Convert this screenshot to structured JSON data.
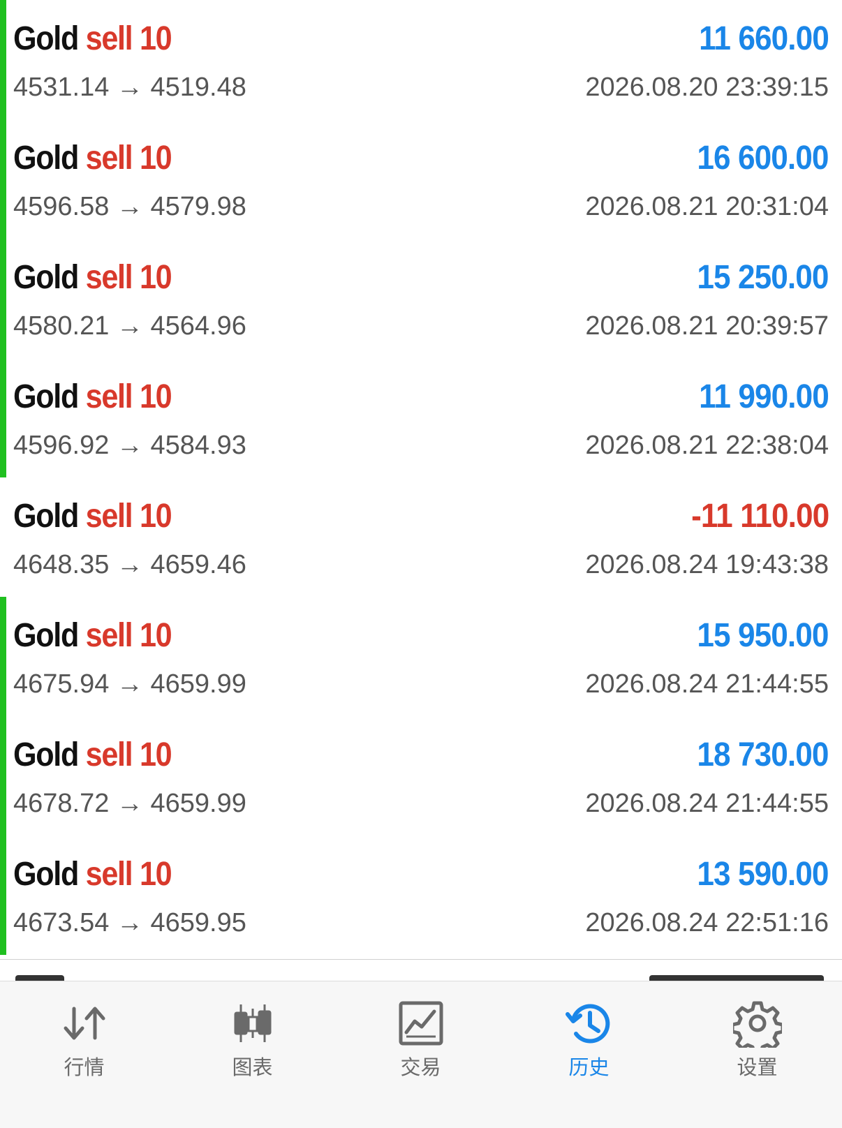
{
  "trades": [
    {
      "symbol": "Gold",
      "side": "sell",
      "volume": "10",
      "prices": "4531.14 → 4519.48",
      "profit": "11 660.00",
      "time": "2026.08.20 23:39:15",
      "is_loss": false
    },
    {
      "symbol": "Gold",
      "side": "sell",
      "volume": "10",
      "prices": "4596.58 → 4579.98",
      "profit": "16 600.00",
      "time": "2026.08.21 20:31:04",
      "is_loss": false
    },
    {
      "symbol": "Gold",
      "side": "sell",
      "volume": "10",
      "prices": "4580.21 → 4564.96",
      "profit": "15 250.00",
      "time": "2026.08.21 20:39:57",
      "is_loss": false
    },
    {
      "symbol": "Gold",
      "side": "sell",
      "volume": "10",
      "prices": "4596.92 → 4584.93",
      "profit": "11 990.00",
      "time": "2026.08.21 22:38:04",
      "is_loss": false
    },
    {
      "symbol": "Gold",
      "side": "sell",
      "volume": "10",
      "prices": "4648.35 → 4659.46",
      "profit": "-11 110.00",
      "time": "2026.08.24 19:43:38",
      "is_loss": true
    },
    {
      "symbol": "Gold",
      "side": "sell",
      "volume": "10",
      "prices": "4675.94 → 4659.99",
      "profit": "15 950.00",
      "time": "2026.08.24 21:44:55",
      "is_loss": false
    },
    {
      "symbol": "Gold",
      "side": "sell",
      "volume": "10",
      "prices": "4678.72 → 4659.99",
      "profit": "18 730.00",
      "time": "2026.08.24 21:44:55",
      "is_loss": false
    },
    {
      "symbol": "Gold",
      "side": "sell",
      "volume": "10",
      "prices": "4673.54 → 4659.95",
      "profit": "13 590.00",
      "time": "2026.08.24 22:51:16",
      "is_loss": false
    }
  ],
  "colors": {
    "profit": "#1a86e8",
    "loss": "#d8392b",
    "profit_bar": "#20c020",
    "active_tab": "#1a86e8",
    "inactive_tab": "#6a6a6a"
  },
  "tabbar": {
    "tabs": [
      {
        "label": "行情",
        "icon": "quotes-arrows-icon",
        "active": false
      },
      {
        "label": "图表",
        "icon": "candlestick-chart-icon",
        "active": false
      },
      {
        "label": "交易",
        "icon": "trade-chart-icon",
        "active": false
      },
      {
        "label": "历史",
        "icon": "history-clock-icon",
        "active": true
      },
      {
        "label": "设置",
        "icon": "gear-icon",
        "active": false
      }
    ]
  }
}
